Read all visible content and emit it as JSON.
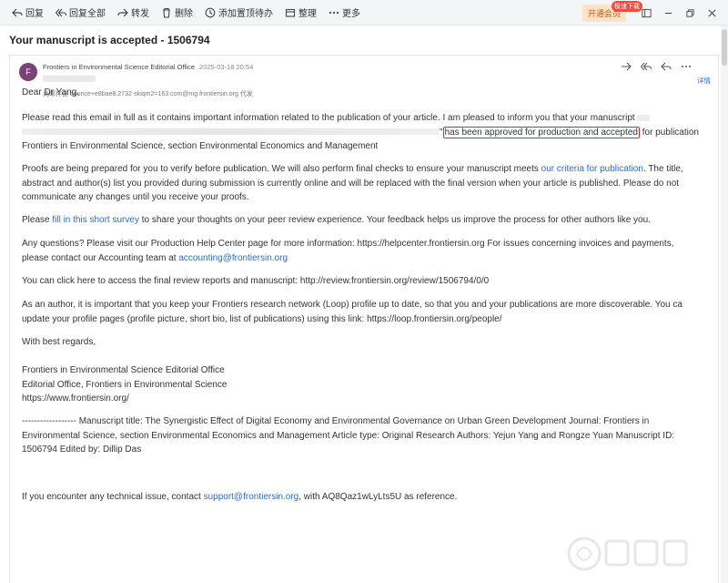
{
  "toolbar": {
    "reply": "回复",
    "reply_all": "回复全部",
    "forward": "转发",
    "delete": "删除",
    "pin_todo": "添加置顶待办",
    "organize": "整理",
    "more": "更多",
    "vip": "开通会员",
    "vip_badge": "极速下载"
  },
  "email": {
    "subject": "Your manuscript is accepted - 1506794",
    "avatar_letter": "F",
    "sender": "Frontiers in Environmental Science Editorial Office",
    "date": "2025-03-18 20:54",
    "via": "此邮件由 bounce+e8bae8.2732-skiqm2=163.com@mg.frontiersin.org 代发",
    "details": "详情"
  },
  "body": {
    "greeting": "Dear Dr Yang,",
    "p1_l1": "Please read this email in full as it contains important information related to the publication of your article. I am pleased to inform you that your manuscript",
    "p1_l2_quote_end": "\"",
    "p1_highlight": "has been approved for production and accepted",
    "p1_l2_tail": "for publication",
    "p1_l3": "Frontiers in Environmental Science, section Environmental Economics and Management",
    "p2_l1_a": "Proofs are being prepared for you to verify before publication. We will also perform final checks to ensure your manuscript meets",
    "p2_link": "our criteria for publication",
    "p2_l1_b": ". The title,",
    "p2_l2": "abstract and author(s) list you provided during submission is currently online and will be replaced with the final version when your article is published. Please do not",
    "p2_l3": "communicate any changes until you receive your proofs.",
    "p3_a": "Please",
    "p3_link": "fill in this short survey",
    "p3_b": "to share your thoughts on your peer review experience. Your feedback helps us improve the process for other authors like you.",
    "p4_l1": "Any questions? Please visit our Production Help Center page for more information: https://helpcenter.frontiersin.org For issues concerning invoices and payments,",
    "p4_l2_a": "please contact our Accounting team at",
    "p4_link": "accounting@frontiersin.org",
    "p5": "You can click here to access the final review reports and manuscript: http://review.frontiersin.org/review/1506794/0/0",
    "p6_l1": "As an author, it is important that you keep your Frontiers research network (Loop) profile up to date, so that you and your publications are more discoverable. You ca",
    "p6_l2": "update your profile pages (profile picture, short bio, list of publications) using this link: https://loop.frontiersin.org/people/",
    "regards": "With best regards,",
    "sig1": "Frontiers in Environmental Science Editorial Office",
    "sig2": "Editorial Office, Frontiers in Environmental Science",
    "sig3": "https://www.frontiersin.org/",
    "meta_l1": "------------------ Manuscript title: The Synergistic Effect of Digital Economy and Environmental Governance on Urban Green Development Journal: Frontiers in",
    "meta_l2": "Environmental Science, section Environmental Economics and Management Article type: Original Research Authors: Yejun Yang and Rongze Yuan Manuscript ID:",
    "meta_l3": "1506794 Edited by: Dillip Das",
    "support_a": "If you encounter any technical issue, contact",
    "support_link": "support@frontiersin.org",
    "support_b": ", with AQ8Qaz1wLyLts5U as reference."
  },
  "colors": {
    "link": "#2a6bc8",
    "highlight_box": "#e02a2a",
    "avatar": "#7a4277",
    "vip_bg": "#ffe3c6"
  }
}
